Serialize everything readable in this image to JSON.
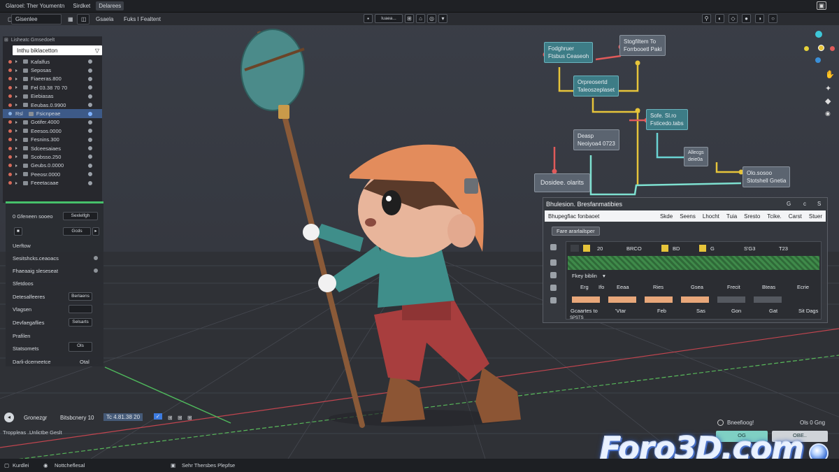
{
  "topbar": {
    "items": [
      "Glaroel: Ther Youmentn",
      "Sirdket",
      "Delarees"
    ],
    "right_icon": "window-icon"
  },
  "toolbar2": {
    "left_items": [
      "Gisenlee",
      "Gsaela",
      "Fuks I Fealtent"
    ],
    "mode_label": "Iuaea..."
  },
  "outliner": {
    "header": "Lisheatc Grnsedoelt",
    "search_text": "Inthu biklacetton",
    "rows": [
      {
        "label": "Kafalfus",
        "dot": "#d76a5a",
        "selected": false
      },
      {
        "label": "Seposas",
        "dot": "#d76a5a",
        "selected": false
      },
      {
        "label": "Fiaeeras.800",
        "dot": "#d76a5a",
        "selected": false
      },
      {
        "label": "Fel 03.38 70 70",
        "dot": "#d76a5a",
        "selected": false
      },
      {
        "label": "Eiebiasas",
        "dot": "#d76a5a",
        "selected": false
      },
      {
        "label": "Eeubas.0.9900",
        "dot": "#d76a5a",
        "selected": false
      },
      {
        "label": "Fsicnpeae",
        "dot": "#8ab4e8",
        "selected": true,
        "prefix": "Rsl"
      },
      {
        "label": "Gotifer.4000",
        "dot": "#d76a5a",
        "selected": false
      },
      {
        "label": "Eeesos.0000",
        "dot": "#d76a5a",
        "selected": false
      },
      {
        "label": "Fesnins.300",
        "dot": "#d76a5a",
        "selected": false
      },
      {
        "label": "Sdceesaiaes",
        "dot": "#d76a5a",
        "selected": false
      },
      {
        "label": "Scobsso.250",
        "dot": "#d76a5a",
        "selected": false
      },
      {
        "label": "Geubs.0.0000",
        "dot": "#d76a5a",
        "selected": false
      },
      {
        "label": "Peeosr.0000",
        "dot": "#d76a5a",
        "selected": false
      },
      {
        "label": "Feeetacaae",
        "dot": "#d76a5a",
        "selected": false
      }
    ]
  },
  "properties": {
    "head_left": "0 Gfeneen sooeo",
    "head_btn": "Sexlelfgh",
    "dropdown": "Gcds",
    "rows": [
      {
        "label": "Uerftow",
        "value": ""
      },
      {
        "label": "Sesitshcks.ceaoacs",
        "value": ""
      },
      {
        "label": "Fhaeaaig sleseseat",
        "value": ""
      },
      {
        "label": "Sfetdoos",
        "value": ""
      },
      {
        "label": "Detesalfeeres",
        "value": "Berlaens"
      },
      {
        "label": "Vlagsen",
        "value": ""
      },
      {
        "label": "Devfaegaflies",
        "value": "Selsarts"
      },
      {
        "label": "Prafilen",
        "value": ""
      },
      {
        "label": "Statsomets",
        "value": "Ols"
      },
      {
        "label": "Darli-dcemeetce",
        "value": "Otal"
      }
    ]
  },
  "nodes": [
    {
      "id": "n1",
      "text": [
        "Fodghruer",
        "Ftsbus Ceaseoh"
      ],
      "style": "teal"
    },
    {
      "id": "n2",
      "text": [
        "Stogfiltem To",
        "Forrbooetl Paki"
      ],
      "style": "slate"
    },
    {
      "id": "n3",
      "text": [
        "Orpreosertd",
        "Taleoszeplaset"
      ],
      "style": "teal"
    },
    {
      "id": "n4",
      "text": [
        "Sofe. Sl.ro",
        "Fsticedo.tabs"
      ],
      "style": "teal"
    },
    {
      "id": "n5",
      "text": [
        "Deasp",
        "Neoiyoa4 0723"
      ],
      "style": "slate"
    },
    {
      "id": "n6",
      "text": [
        "Allecgs",
        "deie0a"
      ],
      "style": "slate"
    },
    {
      "id": "n7",
      "text": [
        "Olo.sosoo",
        "Stotshell Gnetia"
      ],
      "style": "slate"
    },
    {
      "id": "n8",
      "text": [
        "Dosidee. olarits"
      ],
      "style": "slate"
    }
  ],
  "right_panel": {
    "title": "Bhulesion. Bresfanmatibies",
    "icons": [
      "G",
      "c",
      "S"
    ],
    "tabs": [
      "Bhupegfiac fonbaoet",
      "Skde",
      "Seens",
      "Lhocht",
      "Tuia",
      "Sresto",
      "Tcike.",
      "Carst",
      "Stuer"
    ],
    "button": "Fare ararlailsper",
    "grid_header": [
      "20",
      "BRCO",
      "BD",
      "G",
      "S'G3",
      "T23"
    ],
    "grid_row_label": "Fkey biblin",
    "grid_cols": [
      "Erg",
      "Ifo",
      "Eeaa",
      "Ries",
      "Gsea",
      "Frecit",
      "Bteas",
      "Ecrie"
    ],
    "grid_footer": [
      "Gcaartes to",
      "'Vtar",
      "Feb",
      "Sas",
      "Gon",
      "Gat",
      "Sit Dags"
    ],
    "under_grid": "SPSTS"
  },
  "bottombar": {
    "items": [
      "Gronezgr",
      "Bitsbcnery 10",
      "Tc 4.81.38 20"
    ]
  },
  "timeline_labels": [
    "Troppleas ...",
    "Unlictbe Geslt"
  ],
  "statusbar": {
    "items": [
      "Kurdlei",
      "Nottcheflesal",
      "Sehr Thersbes Plepfse"
    ]
  },
  "bottom_right": {
    "title": "Bneefioog!",
    "right_label": "Ols 0 Gng",
    "btn1": "OG",
    "btn2": "OBE.."
  },
  "logo": {
    "text": "Foro3D.com"
  },
  "colors": {
    "accent_blue": "#3d5a88",
    "node_teal": "#3d7c86",
    "props_green": "#46c06a",
    "grid_green": "#3f8a4a",
    "orange_bar": "#e8a77a"
  }
}
